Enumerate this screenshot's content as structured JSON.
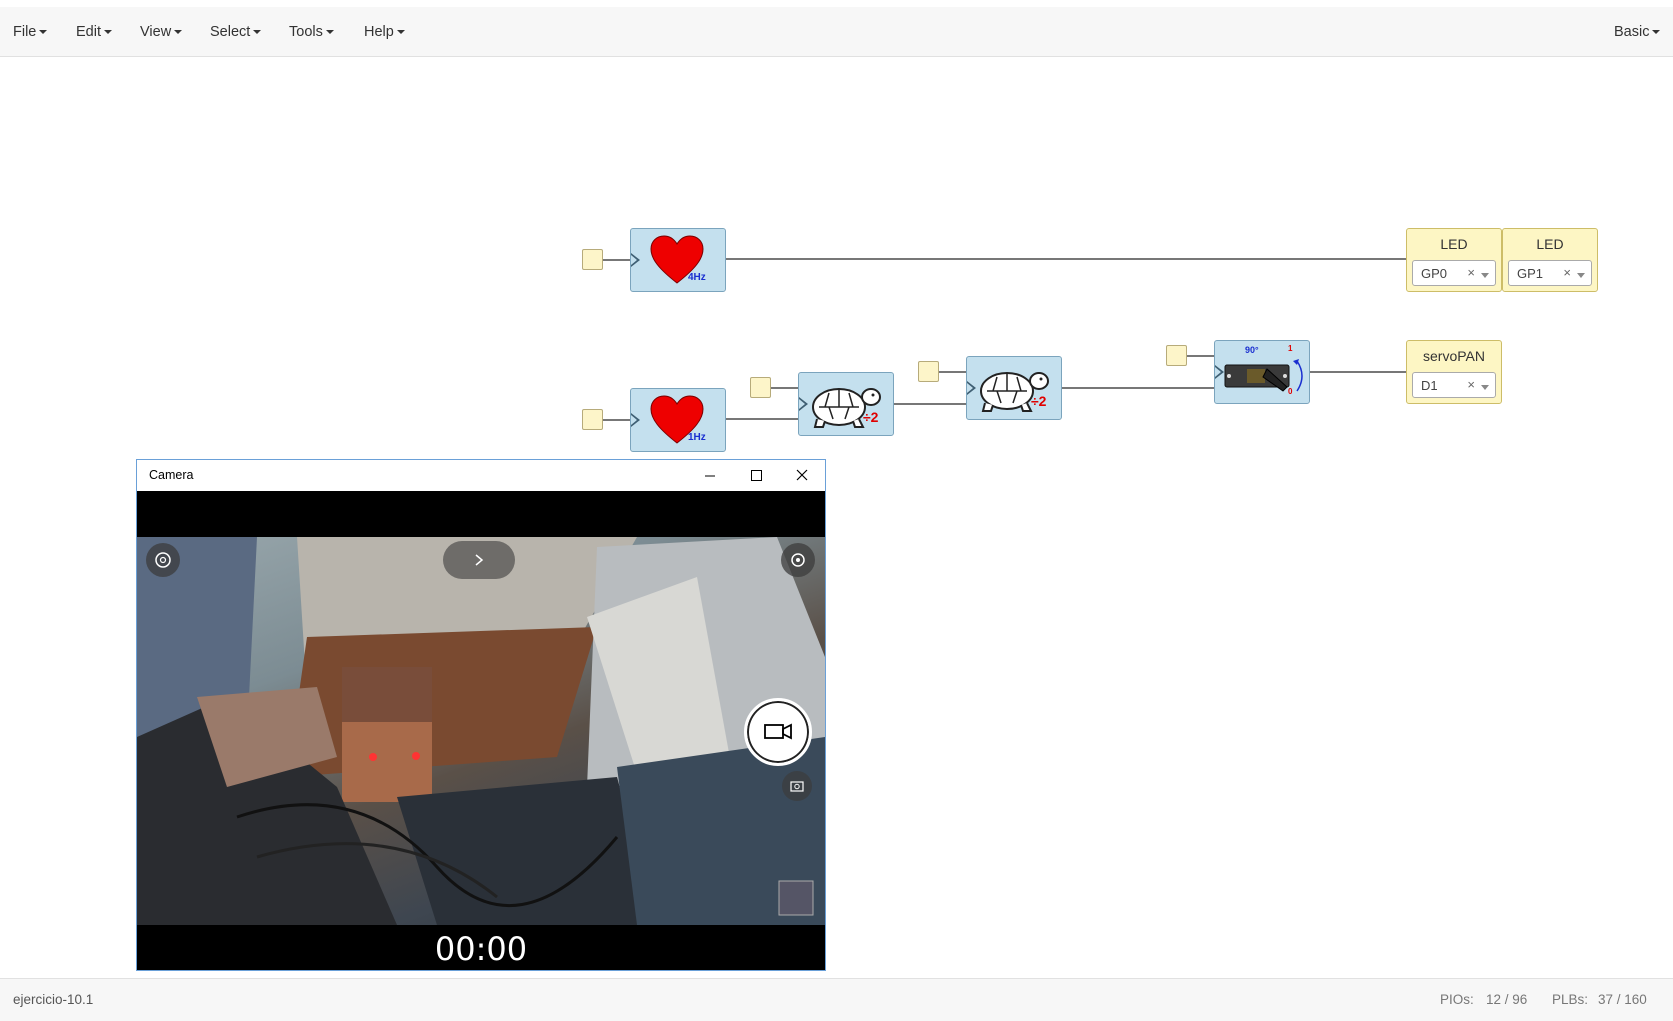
{
  "menubar": {
    "items": [
      "File",
      "Edit",
      "View",
      "Select",
      "Tools",
      "Help"
    ],
    "right": "Basic"
  },
  "blocks": {
    "clock1": {
      "label": "4Hz"
    },
    "clock2": {
      "label": "1Hz"
    },
    "divider1": {
      "label": "÷2"
    },
    "divider2": {
      "label": "÷2"
    },
    "servo": {
      "angle": "90°",
      "one": "1",
      "zero": "0"
    },
    "led0": {
      "title": "LED",
      "pin": "GP0"
    },
    "led1": {
      "title": "LED",
      "pin": "GP1"
    },
    "servo_out": {
      "title": "servoPAN",
      "pin": "D1"
    },
    "clear_symbol": "×"
  },
  "camera": {
    "title": "Camera",
    "timer": "00:00"
  },
  "status": {
    "filename": "ejercicio-10.1",
    "pios_label": "PIOs:",
    "pios_value": "12 / 96",
    "plbs_label": "PLBs:",
    "plbs_value": "37 / 160"
  },
  "colors": {
    "block_blue": "#c4e0ee",
    "output_yellow": "#fdf6c4",
    "heart_red": "#ee0000"
  }
}
